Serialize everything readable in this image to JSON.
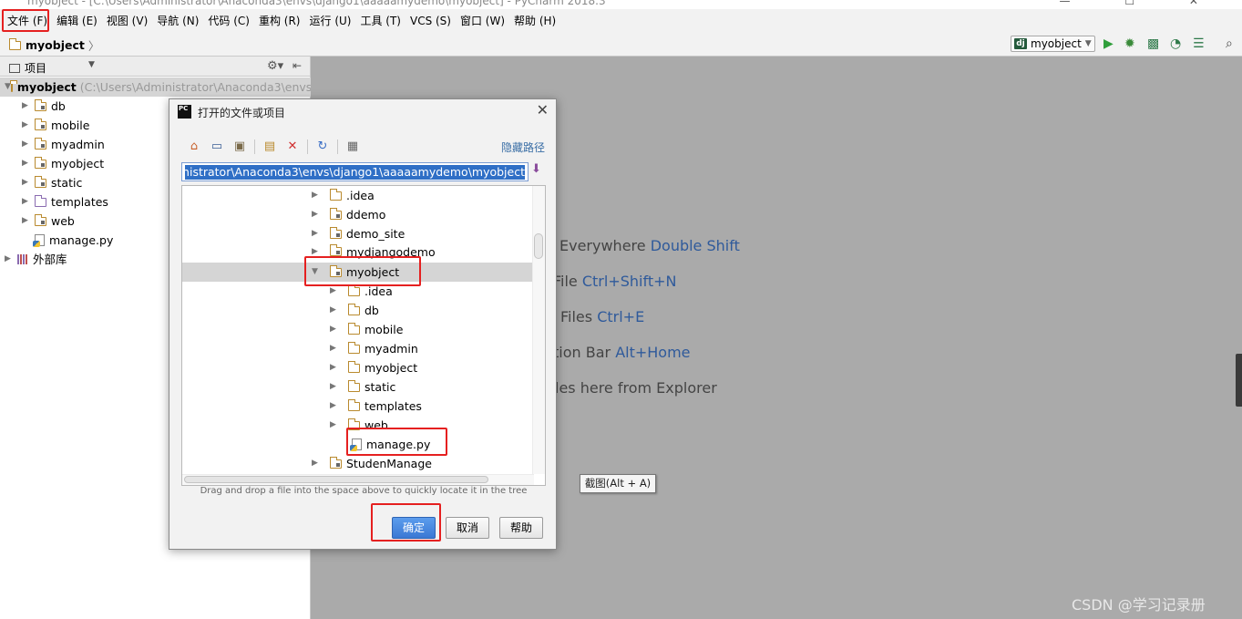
{
  "window": {
    "title": "myobject - [C:\\Users\\Administrator\\Anaconda3\\envs\\django1\\aaaaamydemo\\myobject] - PyCharm 2018.3",
    "controls": "—  ☐  ✕"
  },
  "menu": [
    "文件 (F)",
    "编辑 (E)",
    "视图 (V)",
    "导航 (N)",
    "代码 (C)",
    "重构 (R)",
    "运行 (U)",
    "工具 (T)",
    "VCS (S)",
    "窗口 (W)",
    "帮助 (H)"
  ],
  "breadcrumb": "myobject",
  "run_config": {
    "badge": "dj",
    "label": "myobject"
  },
  "project_panel": {
    "header": "项目",
    "root": {
      "name": "myobject",
      "path": "(C:\\Users\\Administrator\\Anaconda3\\envs"
    },
    "items": [
      "db",
      "mobile",
      "myadmin",
      "myobject",
      "static",
      "templates",
      "web",
      "manage.py"
    ],
    "external": "外部库"
  },
  "editor_hints": [
    {
      "text": "Everywhere ",
      "key": "Double Shift"
    },
    {
      "text": "File ",
      "key": "Ctrl+Shift+N"
    },
    {
      "text": "Files ",
      "key": "Ctrl+E"
    },
    {
      "text": "tion Bar ",
      "key": "Alt+Home"
    },
    {
      "text": "les here from Explorer",
      "key": ""
    }
  ],
  "tooltip": "截图(Alt + A)",
  "watermark": "CSDN @学习记录册",
  "dialog": {
    "title": "打开的文件或项目",
    "hide_path": "隐藏路径",
    "path": "C:\\Users\\Administrator\\Anaconda3\\envs\\django1\\aaaaamydemo\\myobject",
    "path_display": "dministrator\\Anaconda3\\envs\\django1\\aaaaamydemo\\myobject",
    "tree": {
      "parent_items": [
        ".idea",
        "ddemo",
        "demo_site",
        "mydjangodemo"
      ],
      "selected": "myobject",
      "children": [
        ".idea",
        "db",
        "mobile",
        "myadmin",
        "myobject",
        "static",
        "templates",
        "web",
        "manage.py"
      ],
      "after": "StudenManage"
    },
    "dnd_hint": "Drag and drop a file into the space above to quickly locate it in the tree",
    "ok": "确定",
    "cancel": "取消",
    "help": "帮助"
  }
}
